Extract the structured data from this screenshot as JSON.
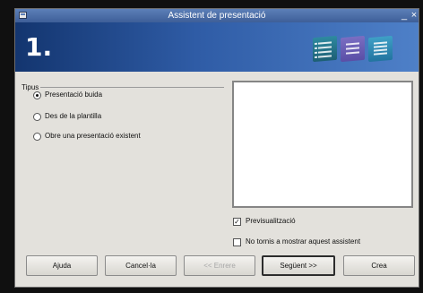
{
  "window": {
    "title": "Assistent de presentació",
    "minimize_label": "_",
    "close_label": "×"
  },
  "banner": {
    "step_label": "1."
  },
  "type_group": {
    "legend": "Tipus",
    "options": [
      {
        "label": "Presentació buida",
        "selected": true
      },
      {
        "label": "Des de la plantilla",
        "selected": false
      },
      {
        "label": "Obre una presentació existent",
        "selected": false
      }
    ]
  },
  "preview_checkbox": {
    "label": "Previsualització",
    "checked": true,
    "mark": "✓"
  },
  "dont_show_checkbox": {
    "label": "No tornis a mostrar aquest assistent",
    "checked": false
  },
  "buttons": {
    "help": "Ajuda",
    "cancel": "Cancel·la",
    "back": "<< Enrere",
    "next": "Següent >>",
    "create": "Crea"
  }
}
